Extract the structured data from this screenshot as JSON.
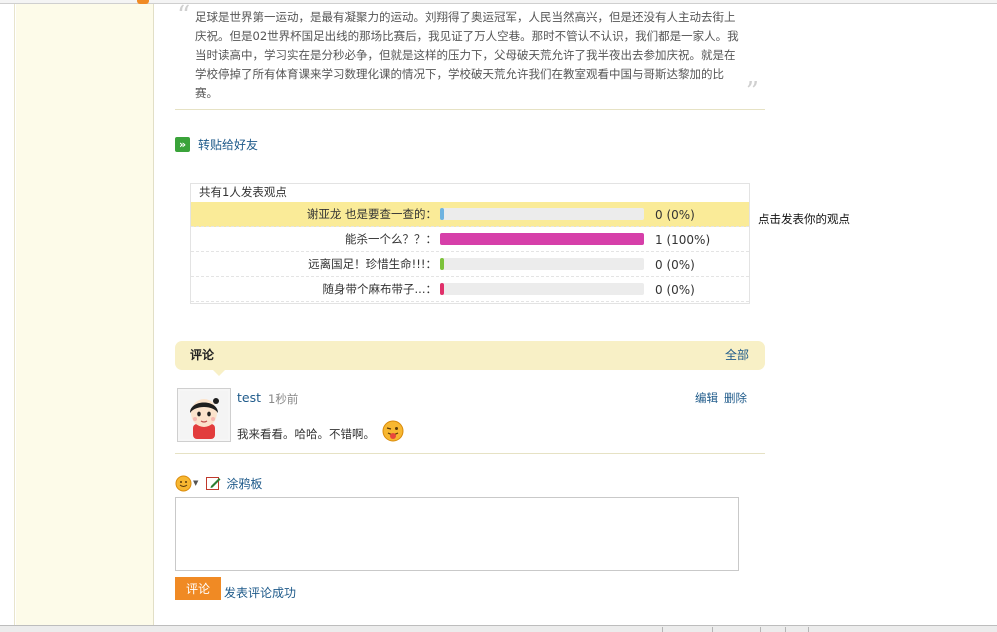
{
  "article": {
    "quote_text": "足球是世界第一运动，是最有凝聚力的运动。刘翔得了奥运冠军，人民当然高兴，但是还没有人主动去街上庆祝。但是02世界杯国足出线的那场比赛后，我见证了万人空巷。那时不管认不认识，我们都是一家人。我当时读高中，学习实在是分秒必争，但就是这样的压力下，父母破天荒允许了我半夜出去参加庆祝。就是在学校停掉了所有体育课来学习数理化课的情况下，学校破天荒允许我们在教室观看中国与哥斯达黎加的比赛。"
  },
  "share": {
    "label": "转贴给好友",
    "icon": "forward-arrows-icon"
  },
  "poll": {
    "header": "共有1人发表观点",
    "side_link": "点击发表你的观点",
    "options": [
      {
        "label": "谢亚龙 也是要查一查的：",
        "result": "0 (0%)",
        "fraction": 0.0,
        "color": "#6fb3e0",
        "highlighted": true
      },
      {
        "label": "能杀一个么？？：",
        "result": "1 (100%)",
        "fraction": 1.0,
        "color": "#d63fa9",
        "highlighted": false
      },
      {
        "label": "远离国足！珍惜生命!!!：",
        "result": "0 (0%)",
        "fraction": 0.0,
        "color": "#7cc23a",
        "highlighted": false
      },
      {
        "label": "随身带个麻布带子...：",
        "result": "0 (0%)",
        "fraction": 0.0,
        "color": "#e0306a",
        "highlighted": false
      }
    ]
  },
  "comments_section": {
    "title": "评论",
    "all_link": "全部",
    "items": [
      {
        "user": "test",
        "time": "1秒前",
        "text": "我来看看。哈哈。不错啊。",
        "edit_label": "编辑",
        "delete_label": "删除",
        "avatar": "girl-avatar",
        "emoticon": "tongue-out-emoticon"
      }
    ]
  },
  "composer": {
    "smiley_icon": "smiley-icon",
    "doodle_label": "涂鸦板",
    "doodle_icon": "pencil-icon",
    "textarea_value": "",
    "submit_label": "评论",
    "status_message": "发表评论成功"
  }
}
